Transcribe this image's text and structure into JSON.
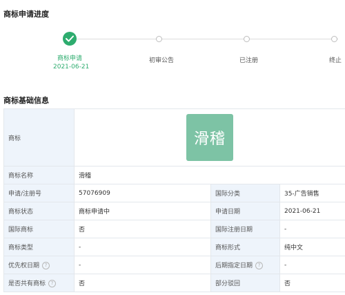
{
  "progress_section": {
    "title": "商标申请进度",
    "steps": [
      {
        "label": "商标申请",
        "date": "2021-06-21",
        "status": "done"
      },
      {
        "label": "初审公告",
        "status": "pending"
      },
      {
        "label": "已注册",
        "status": "pending"
      },
      {
        "label": "终止",
        "status": "pending"
      }
    ]
  },
  "info_section": {
    "title": "商标基础信息",
    "logo": {
      "label": "商标",
      "text": "滑稽",
      "color": "#7dc3a5"
    },
    "name": {
      "label": "商标名称",
      "value": "滑稽"
    },
    "rows": [
      {
        "k1": "申请/注册号",
        "v1": "57076909",
        "k2": "国际分类",
        "v2": "35-广告销售"
      },
      {
        "k1": "商标状态",
        "v1": "商标申请中",
        "k2": "申请日期",
        "v2": "2021-06-21"
      },
      {
        "k1": "国际商标",
        "v1": "否",
        "k2": "国际注册日期",
        "v2": "-"
      },
      {
        "k1": "商标类型",
        "v1": "-",
        "k2": "商标形式",
        "v2": "纯中文"
      },
      {
        "k1": "优先权日期",
        "v1": "-",
        "k2": "后期指定日期",
        "v2": "-"
      },
      {
        "k1": "是否共有商标",
        "v1": "否",
        "k2": "部分驳回",
        "v2": "否"
      }
    ]
  },
  "icons": {
    "check": "check-icon",
    "help": "question-circle-icon"
  },
  "colors": {
    "accent": "#2dac6e",
    "label_bg": "#eef4fb",
    "border": "#e3e7ec"
  }
}
